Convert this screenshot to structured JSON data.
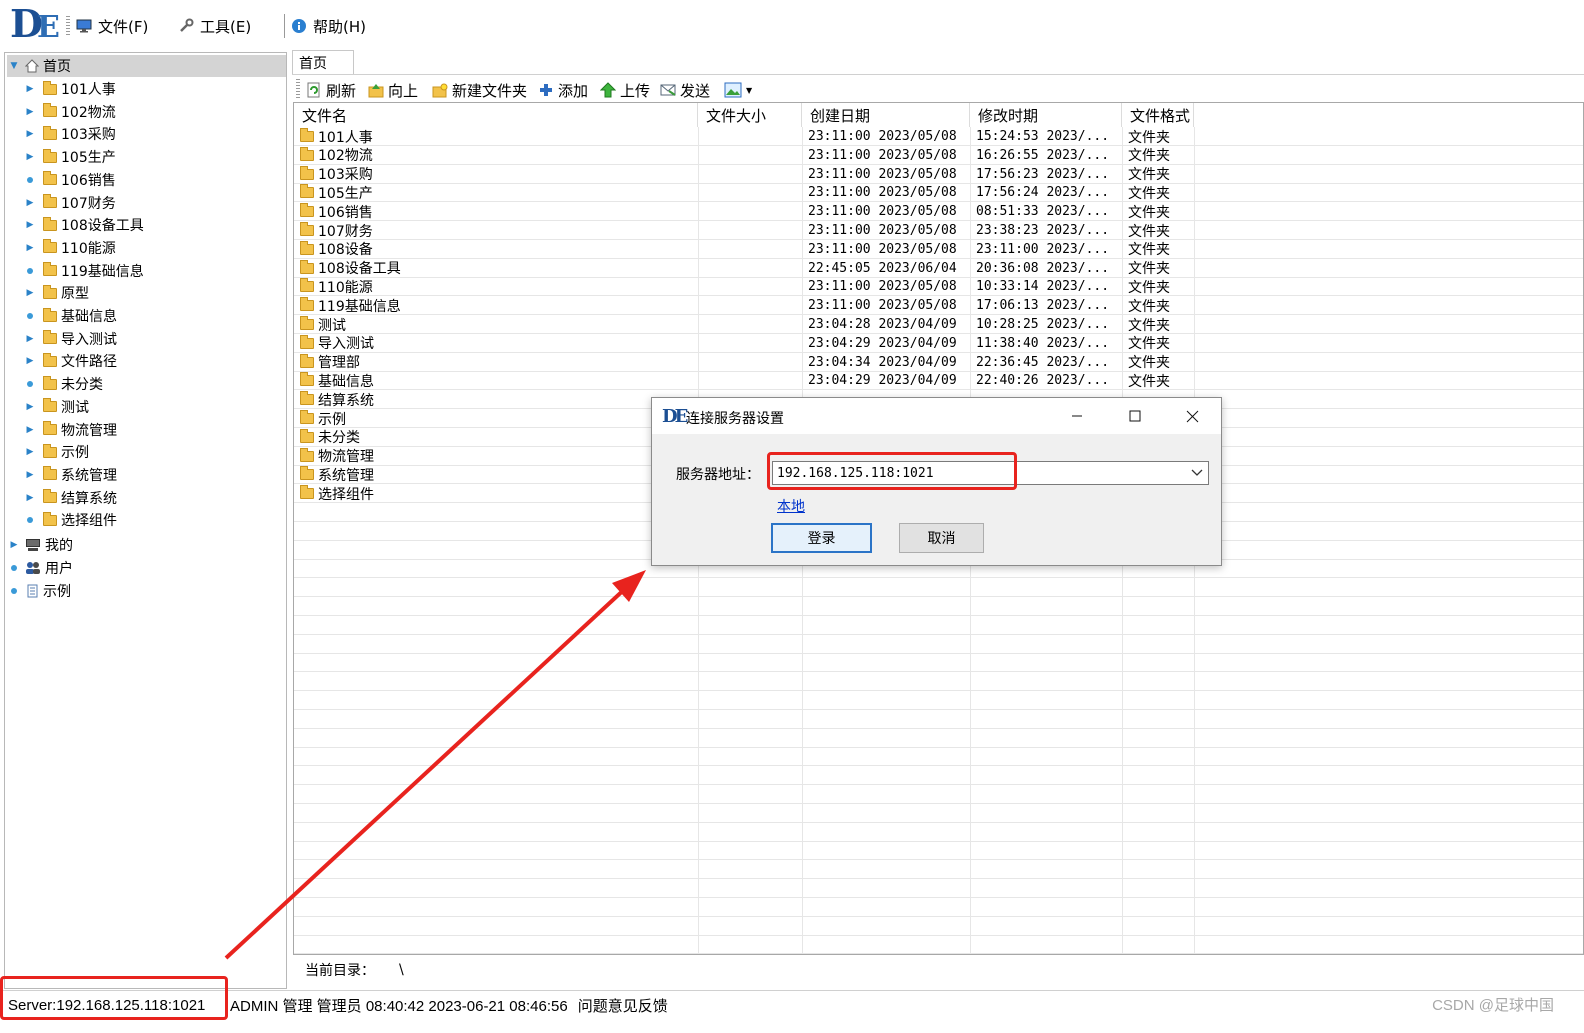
{
  "menu": {
    "logo": "DE",
    "file": "文件(F)",
    "tools": "工具(E)",
    "help": "帮助(H)"
  },
  "tree": {
    "root": "首页",
    "items": [
      "101人事",
      "102物流",
      "103采购",
      "105生产",
      "106销售",
      "107财务",
      "108设备工具",
      "110能源",
      "119基础信息",
      "原型",
      "基础信息",
      "导入测试",
      "文件路径",
      "未分类",
      "测试",
      "物流管理",
      "示例",
      "系统管理",
      "结算系统",
      "选择组件"
    ],
    "bottom": [
      "我的",
      "用户",
      "示例"
    ]
  },
  "tab": {
    "home": "首页"
  },
  "toolbar": {
    "refresh": "刷新",
    "up": "向上",
    "new_folder": "新建文件夹",
    "add": "添加",
    "upload": "上传",
    "send": "发送"
  },
  "columns": [
    "文件名",
    "文件大小",
    "创建日期",
    "修改时期",
    "文件格式"
  ],
  "files": [
    {
      "name": "101人事",
      "created": "23:11:00 2023/05/08",
      "modified": "15:24:53 2023/...",
      "type": "文件夹"
    },
    {
      "name": "102物流",
      "created": "23:11:00 2023/05/08",
      "modified": "16:26:55 2023/...",
      "type": "文件夹"
    },
    {
      "name": "103采购",
      "created": "23:11:00 2023/05/08",
      "modified": "17:56:23 2023/...",
      "type": "文件夹"
    },
    {
      "name": "105生产",
      "created": "23:11:00 2023/05/08",
      "modified": "17:56:24 2023/...",
      "type": "文件夹"
    },
    {
      "name": "106销售",
      "created": "23:11:00 2023/05/08",
      "modified": "08:51:33 2023/...",
      "type": "文件夹"
    },
    {
      "name": "107财务",
      "created": "23:11:00 2023/05/08",
      "modified": "23:38:23 2023/...",
      "type": "文件夹"
    },
    {
      "name": "108设备",
      "created": "23:11:00 2023/05/08",
      "modified": "23:11:00 2023/...",
      "type": "文件夹"
    },
    {
      "name": "108设备工具",
      "created": "22:45:05 2023/06/04",
      "modified": "20:36:08 2023/...",
      "type": "文件夹"
    },
    {
      "name": "110能源",
      "created": "23:11:00 2023/05/08",
      "modified": "10:33:14 2023/...",
      "type": "文件夹"
    },
    {
      "name": "119基础信息",
      "created": "23:11:00 2023/05/08",
      "modified": "17:06:13 2023/...",
      "type": "文件夹"
    },
    {
      "name": "测试",
      "created": "23:04:28 2023/04/09",
      "modified": "10:28:25 2023/...",
      "type": "文件夹"
    },
    {
      "name": "导入测试",
      "created": "23:04:29 2023/04/09",
      "modified": "11:38:40 2023/...",
      "type": "文件夹"
    },
    {
      "name": "管理部",
      "created": "23:04:34 2023/04/09",
      "modified": "22:36:45 2023/...",
      "type": "文件夹"
    },
    {
      "name": "基础信息",
      "created": "23:04:29 2023/04/09",
      "modified": "22:40:26 2023/...",
      "type": "文件夹"
    },
    {
      "name": "结算系统",
      "created": "",
      "modified": "",
      "type": ""
    },
    {
      "name": "示例",
      "created": "",
      "modified": "",
      "type": ""
    },
    {
      "name": "未分类",
      "created": "",
      "modified": "",
      "type": ""
    },
    {
      "name": "物流管理",
      "created": "",
      "modified": "",
      "type": ""
    },
    {
      "name": "系统管理",
      "created": "",
      "modified": "",
      "type": ""
    },
    {
      "name": "选择组件",
      "created": "",
      "modified": "",
      "type": ""
    }
  ],
  "current_dir": {
    "label": "当前目录：",
    "value": "\\"
  },
  "status": {
    "server": "Server:192.168.125.118:1021",
    "user": "ADMIN 管理 管理员 08:40:42 2023-06-21 08:46:56",
    "feedback": "问题意见反馈",
    "watermark": "CSDN @足球中国"
  },
  "dialog": {
    "title": "连接服务器设置",
    "label": "服务器地址：",
    "server_value": "192.168.125.118:1021",
    "local_link": "本地",
    "login": "登录",
    "cancel": "取消"
  },
  "colors": {
    "annotation_red": "#e8231e",
    "link_blue": "#0033cc",
    "logo_blue": "#1c4f93"
  }
}
